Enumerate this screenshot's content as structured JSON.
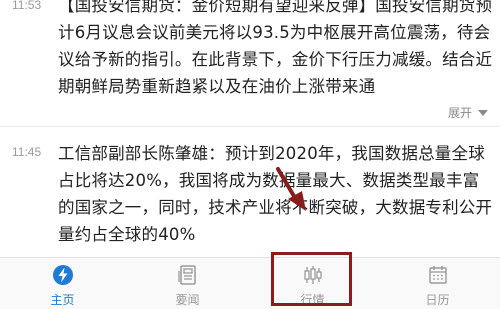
{
  "feed": {
    "items": [
      {
        "time": "11:53",
        "text": "【国投安信期货：金价短期有望迎来反弹】国投安信期货预计6月议息会议前美元将以93.5为中枢展开高位震荡，待会议给予新的指引。在此背景下，金价下行压力减缓。结合近期朝鲜局势重新趋紧以及在油价上涨带来通",
        "expand_label": "展开"
      },
      {
        "time": "11:45",
        "text": "工信部副部长陈肇雄：预计到2020年，我国数据总量全球占比将达20%，我国将成为数据量最大、数据类型最丰富的国家之一，同时，技术产业将不断突破，大数据专利公开量约占全球的40%"
      }
    ]
  },
  "tabbar": {
    "tabs": [
      {
        "label": "主页",
        "icon": "lightning-icon",
        "active": true
      },
      {
        "label": "要闻",
        "icon": "news-icon",
        "active": false
      },
      {
        "label": "行情",
        "icon": "candlestick-icon",
        "active": false
      },
      {
        "label": "日历",
        "icon": "calendar-icon",
        "active": false
      }
    ]
  },
  "colors": {
    "accent": "#1e7bd6",
    "inactive": "#9a9a9a",
    "annotation": "#8b1c1c",
    "text": "#222222"
  }
}
